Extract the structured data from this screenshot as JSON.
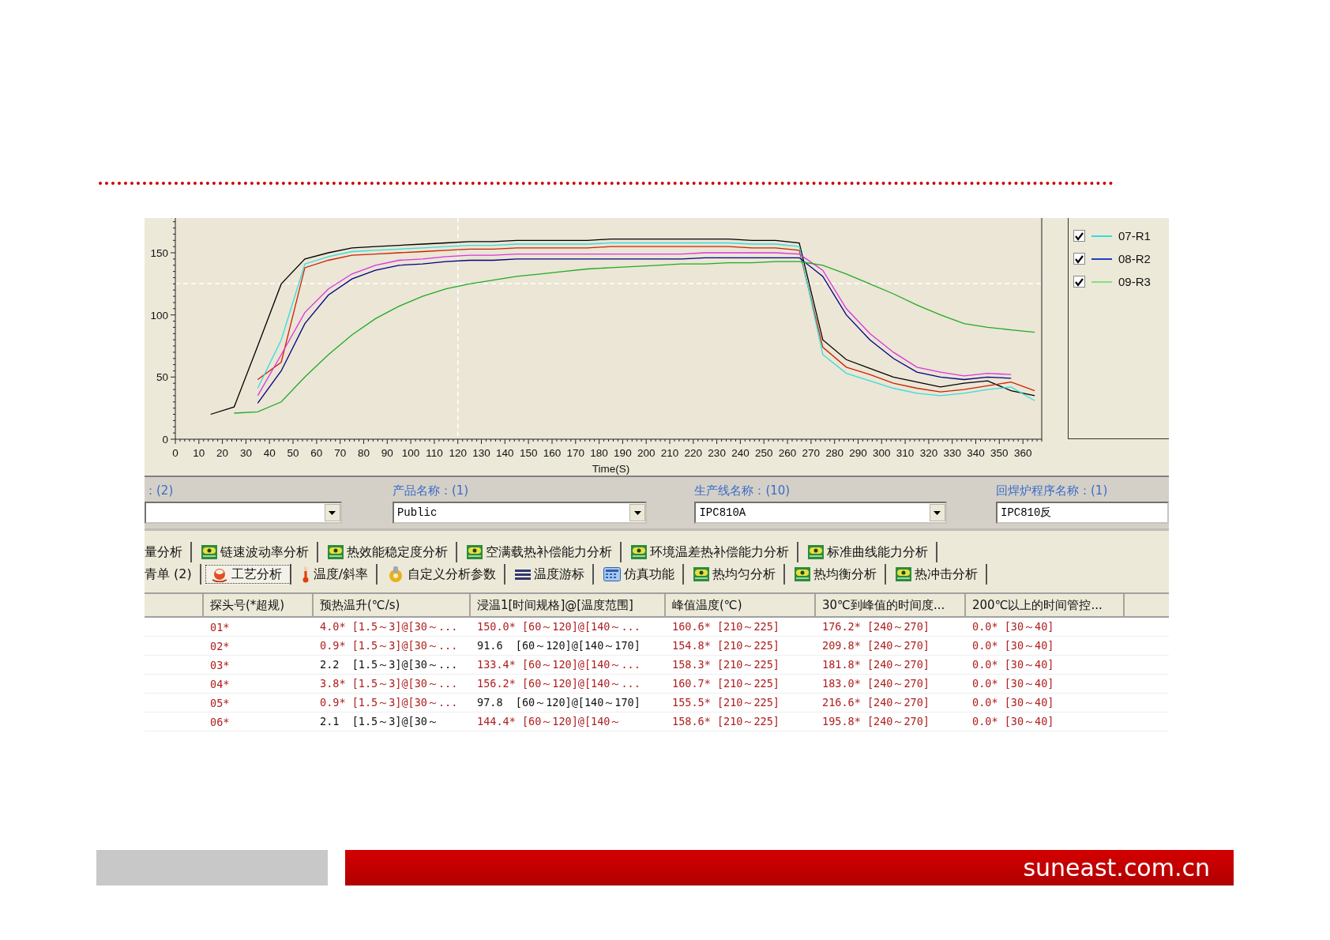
{
  "chart": {
    "chart_data": {
      "type": "line",
      "xlabel": "Time(S)",
      "xlim": [
        0,
        368
      ],
      "ylim": [
        0,
        178
      ],
      "xticks": [
        0,
        10,
        20,
        30,
        40,
        50,
        60,
        70,
        80,
        90,
        100,
        110,
        120,
        130,
        140,
        150,
        160,
        170,
        180,
        190,
        200,
        210,
        220,
        230,
        240,
        250,
        260,
        270,
        280,
        290,
        300,
        310,
        320,
        330,
        340,
        350,
        360
      ],
      "yticks": [
        0,
        50,
        100,
        150
      ],
      "x": [
        15,
        25,
        35,
        45,
        55,
        65,
        75,
        85,
        95,
        105,
        115,
        125,
        135,
        145,
        155,
        165,
        175,
        185,
        195,
        205,
        215,
        225,
        235,
        245,
        255,
        265,
        275,
        285,
        295,
        305,
        315,
        325,
        335,
        345,
        355,
        365
      ],
      "series": [
        {
          "color": "#000000",
          "values": [
            20,
            26,
            75,
            125,
            145,
            150,
            154,
            155,
            156,
            157,
            158,
            159,
            159,
            160,
            160,
            160,
            160,
            161,
            161,
            161,
            161,
            161,
            161,
            160,
            160,
            158,
            80,
            64,
            57,
            50,
            46,
            42,
            45,
            47,
            39,
            35
          ]
        },
        {
          "color": "#cc2200",
          "values": [
            null,
            null,
            48,
            62,
            138,
            144,
            148,
            149,
            150,
            151,
            152,
            153,
            153,
            154,
            154,
            154,
            154,
            155,
            155,
            155,
            155,
            155,
            155,
            154,
            154,
            152,
            74,
            58,
            52,
            45,
            41,
            38,
            40,
            43,
            46,
            39
          ]
        },
        {
          "color": "#33dddd",
          "values": [
            null,
            null,
            41,
            80,
            141,
            147,
            151,
            152,
            153,
            154,
            155,
            156,
            156,
            157,
            157,
            157,
            157,
            158,
            158,
            158,
            158,
            158,
            158,
            157,
            157,
            155,
            68,
            53,
            47,
            41,
            37,
            35,
            37,
            40,
            42,
            31
          ]
        },
        {
          "color": "#dd33dd",
          "values": [
            null,
            null,
            35,
            68,
            102,
            121,
            133,
            140,
            144,
            145,
            147,
            148,
            148,
            149,
            149,
            149,
            149,
            149,
            149,
            149,
            149,
            150,
            150,
            150,
            150,
            149,
            136,
            105,
            85,
            70,
            58,
            54,
            51,
            53,
            52,
            null
          ]
        },
        {
          "color": "#000080",
          "values": [
            null,
            null,
            29,
            55,
            93,
            116,
            129,
            136,
            140,
            141,
            143,
            144,
            144,
            145,
            145,
            145,
            145,
            145,
            145,
            145,
            145,
            146,
            146,
            146,
            146,
            146,
            131,
            100,
            80,
            65,
            54,
            50,
            48,
            50,
            49,
            null
          ]
        },
        {
          "color": "#22aa22",
          "values": [
            null,
            21,
            22,
            30,
            50,
            68,
            84,
            97,
            107,
            115,
            121,
            125,
            128,
            131,
            133,
            135,
            137,
            138,
            139,
            140,
            141,
            141,
            142,
            142,
            143,
            143,
            140,
            133,
            125,
            117,
            108,
            100,
            93,
            90,
            88,
            86
          ]
        }
      ]
    },
    "legend": [
      {
        "label": "07-R1",
        "checked": true,
        "color": "#33dddd"
      },
      {
        "label": "08-R2",
        "checked": true,
        "color": "#2040c0"
      },
      {
        "label": "09-R3",
        "checked": true,
        "color": "#80e080"
      }
    ]
  },
  "filters": [
    {
      "label": "：(2)",
      "dropdown": true
    },
    {
      "label": "产品名称：(1)",
      "value": "Public",
      "dropdown": true
    },
    {
      "label": "生产线名称：(10)",
      "value": "IPC810A",
      "dropdown": true
    },
    {
      "label": "回焊炉程序名称：(1)",
      "value": "IPC810反",
      "dropdown": false
    }
  ],
  "tab_rows": [
    {
      "tabs": [
        {
          "label": "量分析",
          "kind": "none",
          "selected": false
        },
        {
          "label": "链速波动率分析",
          "kind": "plugin",
          "selected": false
        },
        {
          "label": "热效能稳定度分析",
          "kind": "plugin",
          "selected": false
        },
        {
          "label": "空满载热补偿能力分析",
          "kind": "plugin",
          "selected": false
        },
        {
          "label": "环境温差热补偿能力分析",
          "kind": "plugin",
          "selected": false
        },
        {
          "label": "标准曲线能力分析",
          "kind": "plugin",
          "selected": false
        }
      ]
    },
    {
      "tabs": [
        {
          "label": "青单 (2)",
          "kind": "none",
          "selected": false
        },
        {
          "label": "工艺分析",
          "kind": "flask",
          "selected": true
        },
        {
          "label": "温度/斜率",
          "kind": "thermo",
          "selected": false
        },
        {
          "label": "自定义分析参数",
          "kind": "coin",
          "selected": false
        },
        {
          "label": "温度游标",
          "kind": "lines",
          "selected": false
        },
        {
          "label": "仿真功能",
          "kind": "calc",
          "selected": false
        },
        {
          "label": "热均匀分析",
          "kind": "plugin",
          "selected": false
        },
        {
          "label": "热均衡分析",
          "kind": "plugin",
          "selected": false
        },
        {
          "label": "热冲击分析",
          "kind": "plugin",
          "selected": false
        }
      ]
    }
  ],
  "table": {
    "columns": [
      "探头号(*超规)",
      "预热温升(℃/s)",
      "浸温1[时间规格]@[温度范围]",
      "峰值温度(℃)",
      "30℃到峰值的时间度...",
      "200℃以上的时间管控..."
    ],
    "rows": [
      {
        "cells": [
          {
            "text": "01*",
            "alarm": true
          },
          {
            "text": "4.0* [1.5～3]@[30～...",
            "alarm": true
          },
          {
            "text": "150.0* [60～120]@[140～...",
            "alarm": true
          },
          {
            "text": "160.6* [210～225]",
            "alarm": true
          },
          {
            "text": "176.2* [240～270]",
            "alarm": true
          },
          {
            "text": "0.0* [30～40]",
            "alarm": true
          }
        ]
      },
      {
        "cells": [
          {
            "text": "02*",
            "alarm": true
          },
          {
            "text": "0.9* [1.5～3]@[30～...",
            "alarm": true
          },
          {
            "text": "91.6  [60～120]@[140～170]",
            "alarm": false
          },
          {
            "text": "154.8* [210～225]",
            "alarm": true
          },
          {
            "text": "209.8* [240～270]",
            "alarm": true
          },
          {
            "text": "0.0* [30～40]",
            "alarm": true
          }
        ]
      },
      {
        "cells": [
          {
            "text": "03*",
            "alarm": true
          },
          {
            "text": "2.2  [1.5～3]@[30～...",
            "alarm": false
          },
          {
            "text": "133.4* [60～120]@[140～...",
            "alarm": true
          },
          {
            "text": "158.3* [210～225]",
            "alarm": true
          },
          {
            "text": "181.8* [240～270]",
            "alarm": true
          },
          {
            "text": "0.0* [30～40]",
            "alarm": true
          }
        ]
      },
      {
        "cells": [
          {
            "text": "04*",
            "alarm": true
          },
          {
            "text": "3.8* [1.5～3]@[30～...",
            "alarm": true
          },
          {
            "text": "156.2* [60～120]@[140～...",
            "alarm": true
          },
          {
            "text": "160.7* [210～225]",
            "alarm": true
          },
          {
            "text": "183.0* [240～270]",
            "alarm": true
          },
          {
            "text": "0.0* [30～40]",
            "alarm": true
          }
        ]
      },
      {
        "cells": [
          {
            "text": "05*",
            "alarm": true
          },
          {
            "text": "0.9* [1.5～3]@[30～...",
            "alarm": true
          },
          {
            "text": "97.8  [60～120]@[140～170]",
            "alarm": false
          },
          {
            "text": "155.5* [210～225]",
            "alarm": true
          },
          {
            "text": "216.6* [240～270]",
            "alarm": true
          },
          {
            "text": "0.0* [30～40]",
            "alarm": true
          }
        ]
      },
      {
        "cells": [
          {
            "text": "06*",
            "alarm": true
          },
          {
            "text": "2.1  [1.5～3]@[30～",
            "alarm": false
          },
          {
            "text": "144.4* [60～120]@[140～",
            "alarm": true
          },
          {
            "text": "158.6* [210～225]",
            "alarm": true
          },
          {
            "text": "195.8* [240～270]",
            "alarm": true
          },
          {
            "text": "0.0* [30～40]",
            "alarm": true
          }
        ]
      }
    ]
  },
  "footer": {
    "url": "suneast.com.cn"
  }
}
